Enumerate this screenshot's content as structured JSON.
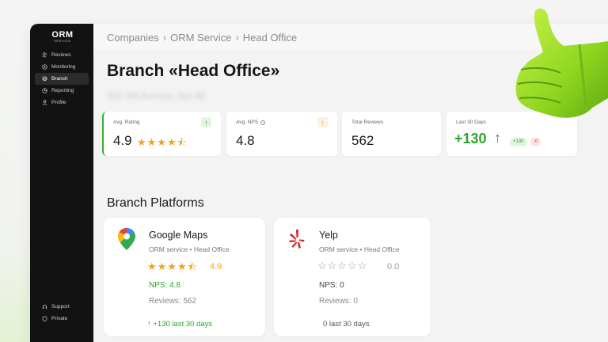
{
  "brand": {
    "name": "ORM",
    "tagline": "SERVICE"
  },
  "sidebar": {
    "items": [
      {
        "label": "Reviews",
        "icon": "users-icon",
        "active": false
      },
      {
        "label": "Monitoring",
        "icon": "monitor-icon",
        "active": false
      },
      {
        "label": "Branch",
        "icon": "branch-icon",
        "active": true
      },
      {
        "label": "Reporting",
        "icon": "report-icon",
        "active": false
      },
      {
        "label": "Profile",
        "icon": "user-icon",
        "active": false
      }
    ],
    "bottom": [
      {
        "label": "Support",
        "icon": "support-icon"
      },
      {
        "label": "Private",
        "icon": "lock-icon"
      }
    ]
  },
  "breadcrumb": [
    "Companies",
    "ORM Service",
    "Head Office"
  ],
  "page": {
    "title": "Branch «Head Office»",
    "address": "350 5th Avenue, Apt 48"
  },
  "stats": {
    "rating": {
      "label": "Avg. Rating",
      "value": "4.9",
      "stars": "★★★★⯪",
      "badge": "↑"
    },
    "nps": {
      "label": "Avg. NPS",
      "value": "4.8",
      "badge": "↑"
    },
    "total": {
      "label": "Total Reviews",
      "value": "562"
    },
    "recent": {
      "label": "Last 30 Days",
      "value": "+130",
      "arrow": "↑",
      "positive": "+130",
      "negative": "-0"
    }
  },
  "platforms_title": "Branch Platforms",
  "platforms": [
    {
      "name": "Google Maps",
      "subtitle": "ORM service • Head Office",
      "stars": "★★★★⯪",
      "rating": "4.9",
      "nps": "NPS: 4.8",
      "reviews": "Reviews: 562",
      "recent": "↑ +130 last 30 days"
    },
    {
      "name": "Yelp",
      "subtitle": "ORM service • Head Office",
      "stars": "☆☆☆☆☆",
      "rating": "0.0",
      "nps": "NPS: 0",
      "reviews": "Reviews: 0",
      "recent": "0 last 30 days"
    }
  ],
  "colors": {
    "accent_green": "#2aa52a",
    "star": "#f4a21c",
    "negative": "#e04848",
    "sidebar_bg": "#121212"
  }
}
